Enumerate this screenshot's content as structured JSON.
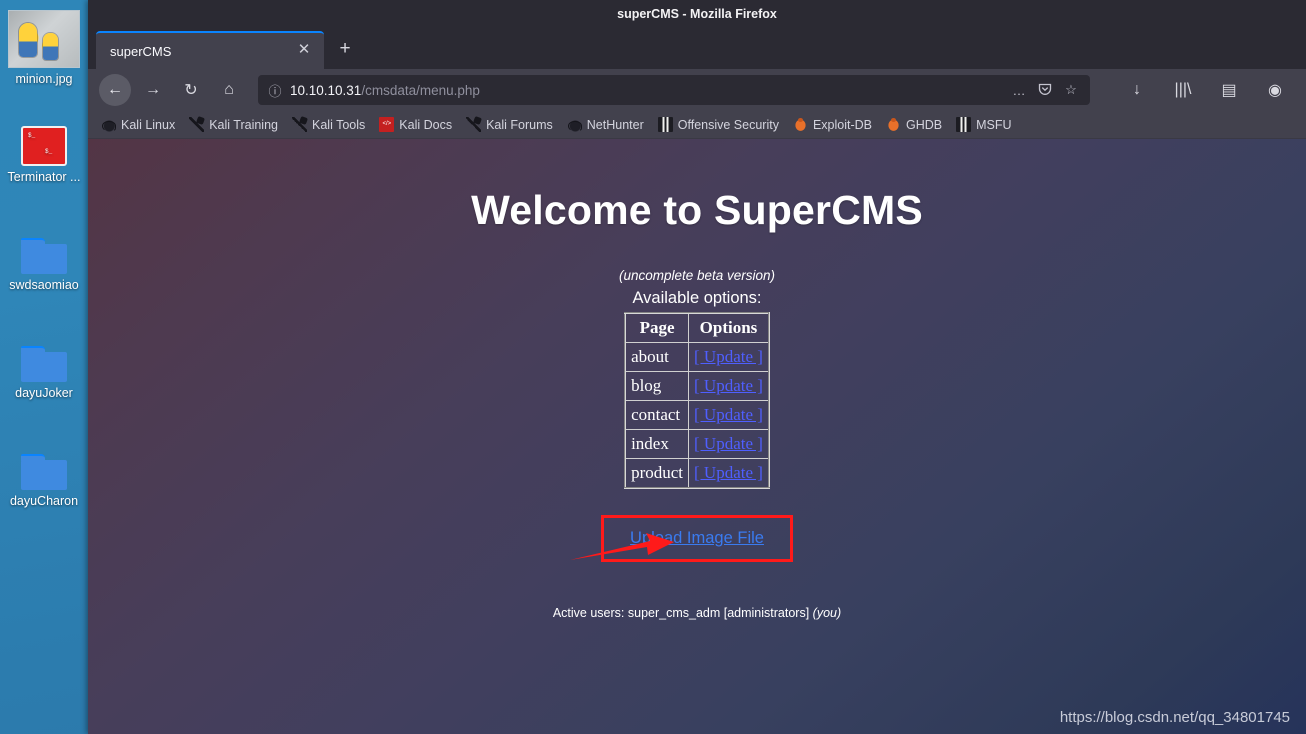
{
  "desktop": {
    "icons": [
      {
        "label": "minion.jpg",
        "type": "image-thumbnail",
        "icon": "image-file-icon"
      },
      {
        "label": "Terminator ...",
        "type": "image-thumbnail",
        "icon": "terminator-file-icon"
      },
      {
        "label": "swdsaomiao",
        "type": "folder",
        "icon": "folder-icon"
      },
      {
        "label": "dayuJoker",
        "type": "folder",
        "icon": "folder-icon"
      },
      {
        "label": "dayuCharon",
        "type": "folder",
        "icon": "folder-icon"
      }
    ]
  },
  "browser": {
    "window_title": "superCMS - Mozilla Firefox",
    "tab": {
      "title": "superCMS",
      "close_label": "✕"
    },
    "new_tab_label": "+",
    "nav": {
      "back": "←",
      "forward": "→",
      "reload": "↻",
      "home": "⌂"
    },
    "urlbar": {
      "info_icon": "ⓘ",
      "host": "10.10.10.31",
      "path": "/cmsdata/menu.php",
      "page_actions": "…",
      "pocket": "♥",
      "bookmark_star": "☆"
    },
    "toolbar_end": {
      "downloads": "↓",
      "library": "|||\\",
      "sidebars": "▤",
      "account": "◉"
    },
    "bookmarks": [
      {
        "label": "Kali Linux",
        "icon": "kali-dragon-icon"
      },
      {
        "label": "Kali Training",
        "icon": "wrench-icon"
      },
      {
        "label": "Kali Tools",
        "icon": "wrench-icon"
      },
      {
        "label": "Kali Docs",
        "icon": "red-book-icon"
      },
      {
        "label": "Kali Forums",
        "icon": "wrench-icon"
      },
      {
        "label": "NetHunter",
        "icon": "kali-dragon-icon"
      },
      {
        "label": "Offensive Security",
        "icon": "metasploit-icon"
      },
      {
        "label": "Exploit-DB",
        "icon": "bug-icon"
      },
      {
        "label": "GHDB",
        "icon": "bug-icon"
      },
      {
        "label": "MSFU",
        "icon": "metasploit-icon"
      }
    ]
  },
  "page": {
    "title": "Welcome to SuperCMS",
    "beta_note": "(uncomplete beta version)",
    "available_label": "Available options:",
    "table": {
      "headers": [
        "Page",
        "Options"
      ],
      "rows": [
        {
          "page": "about",
          "option": "[ Update ]"
        },
        {
          "page": "blog",
          "option": "[ Update ]"
        },
        {
          "page": "contact",
          "option": "[ Update ]"
        },
        {
          "page": "index",
          "option": "[ Update ]"
        },
        {
          "page": "product",
          "option": "[ Update ]"
        }
      ]
    },
    "upload_link": "Upload Image File",
    "active_users_prefix": "Active users: super_cms_adm [administrators]",
    "active_users_you": "(you)",
    "watermark": "https://blog.csdn.net/qq_34801745"
  },
  "colors": {
    "annotation_red": "#ff1a1a",
    "link_blue": "#4f5fff",
    "upload_link_blue": "#3a7bf0",
    "tab_accent": "#0a84ff",
    "chrome_bg": "#42414d",
    "chrome_dark": "#2b2a33",
    "desktop_blue": "#2e86b8"
  }
}
